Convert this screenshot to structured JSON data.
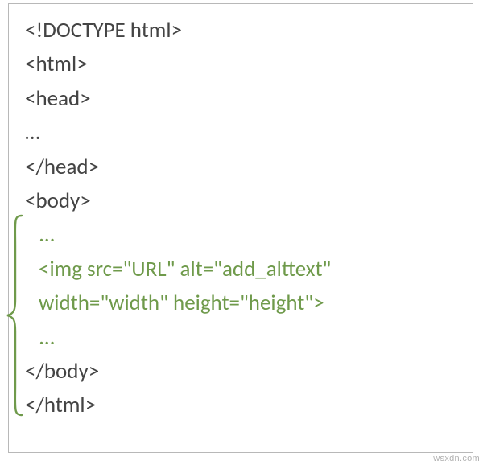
{
  "code": {
    "l1": "<!DOCTYPE html>",
    "l2": "<html>",
    "l3": "<head>",
    "l4": "…",
    "l5": "</head>",
    "l6": "<body>",
    "l7": "…",
    "l8a": "<img src=\"URL\" alt=\"add_alttext\"",
    "l8b": "width=\"width\" height=\"height\">",
    "l9": "…",
    "l10": "</body>",
    "l11": "</html>"
  },
  "watermark": "wsxdn.com"
}
